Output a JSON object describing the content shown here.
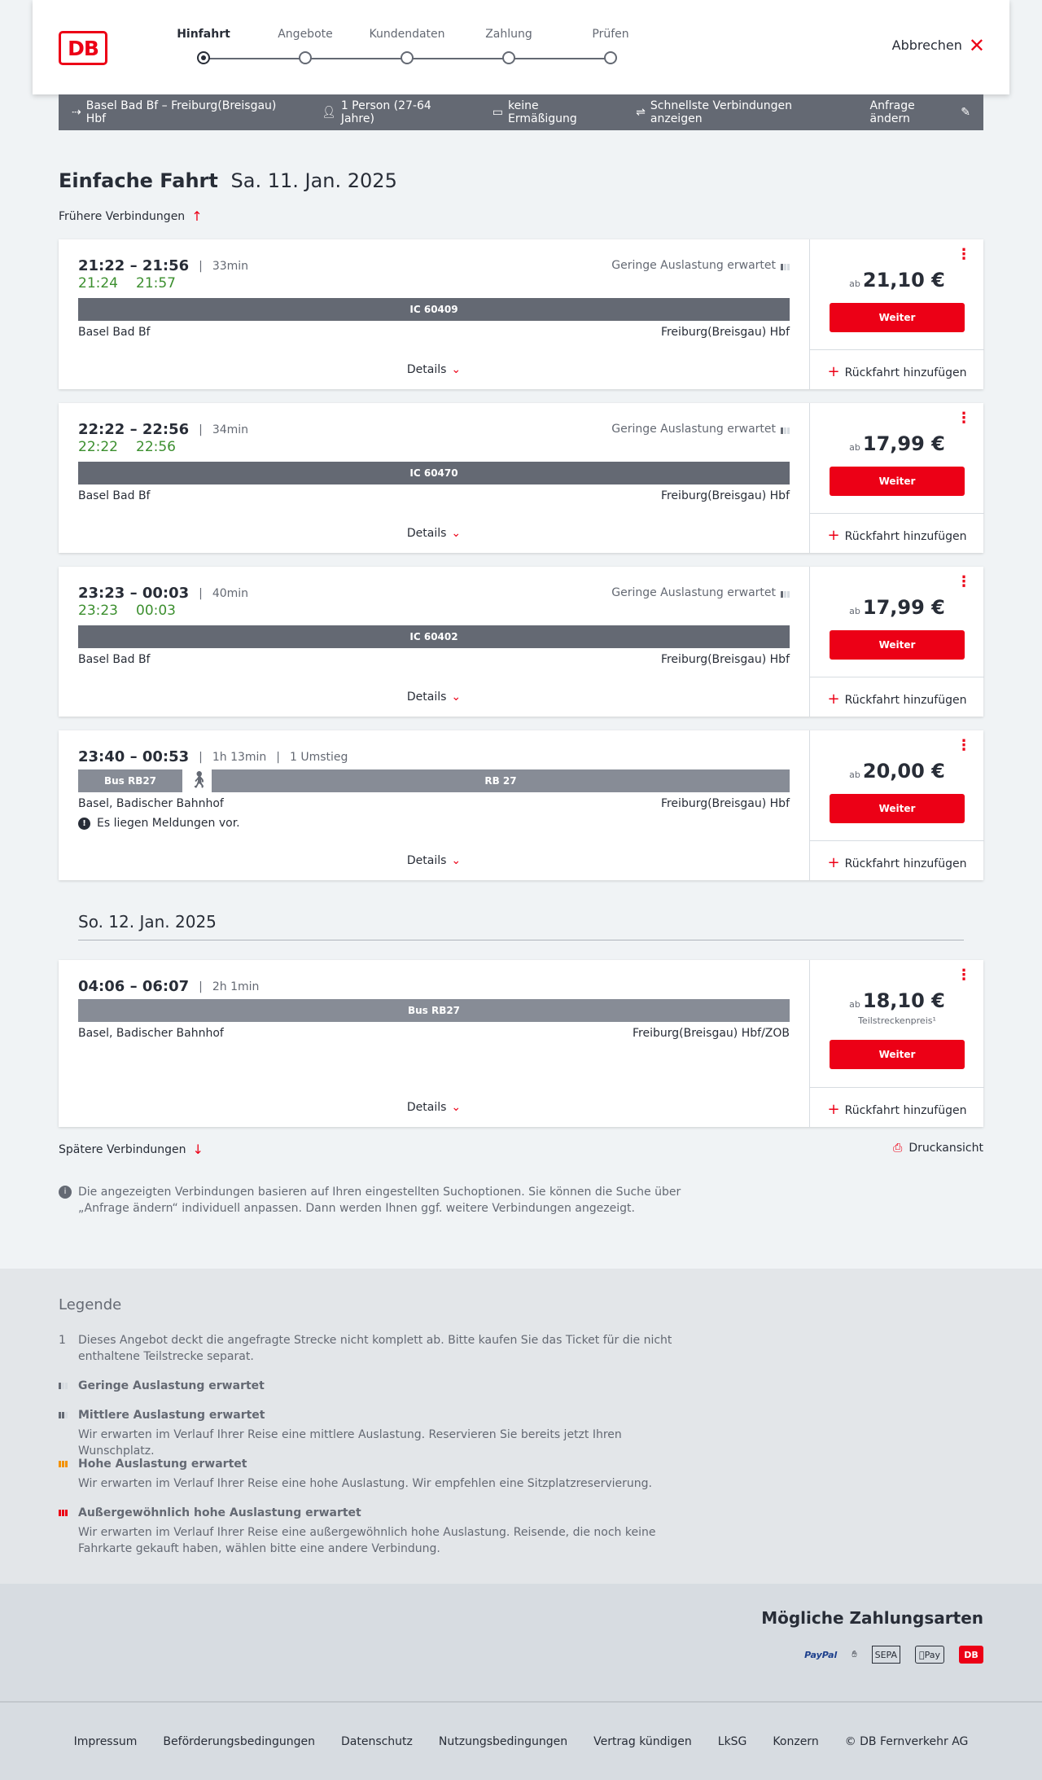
{
  "header": {
    "logo": "DB",
    "steps": [
      "Hinfahrt",
      "Angebote",
      "Kundendaten",
      "Zahlung",
      "Prüfen"
    ],
    "cancel": "Abbrechen"
  },
  "summary": {
    "route": "Basel Bad Bf – Freiburg(Breisgau) Hbf",
    "passengers": "1 Person (27-64 Jahre)",
    "discount": "keine Ermäßigung",
    "option": "Schnellste Verbindungen anzeigen",
    "edit": "Anfrage ändern"
  },
  "title": {
    "main": "Einfache Fahrt",
    "date": "Sa. 11. Jan. 2025"
  },
  "earlier": "Frühere Verbindungen",
  "later": "Spätere Verbindungen",
  "print": "Druckansicht",
  "connections": [
    {
      "times": "21:22 – 21:56",
      "duration": "33min",
      "transfers": "",
      "rt_dep": "21:24",
      "rt_arr": "21:57",
      "load": "Geringe Auslastung erwartet",
      "trains": [
        "IC 60409"
      ],
      "from": "Basel Bad Bf",
      "to": "Freiburg(Breisgau) Hbf",
      "details": "Details",
      "ab": "ab",
      "price": "21,10 €",
      "partial": "",
      "weiter": "Weiter",
      "return": "Rückfahrt hinzufügen",
      "notice": ""
    },
    {
      "times": "22:22 – 22:56",
      "duration": "34min",
      "transfers": "",
      "rt_dep": "22:22",
      "rt_arr": "22:56",
      "load": "Geringe Auslastung erwartet",
      "trains": [
        "IC 60470"
      ],
      "from": "Basel Bad Bf",
      "to": "Freiburg(Breisgau) Hbf",
      "details": "Details",
      "ab": "ab",
      "price": "17,99 €",
      "partial": "",
      "weiter": "Weiter",
      "return": "Rückfahrt hinzufügen",
      "notice": ""
    },
    {
      "times": "23:23 – 00:03",
      "duration": "40min",
      "transfers": "",
      "rt_dep": "23:23",
      "rt_arr": "00:03",
      "load": "Geringe Auslastung erwartet",
      "trains": [
        "IC 60402"
      ],
      "from": "Basel Bad Bf",
      "to": "Freiburg(Breisgau) Hbf",
      "details": "Details",
      "ab": "ab",
      "price": "17,99 €",
      "partial": "",
      "weiter": "Weiter",
      "return": "Rückfahrt hinzufügen",
      "notice": ""
    },
    {
      "times": "23:40 – 00:53",
      "duration": "1h 13min",
      "transfers": "1 Umstieg",
      "rt_dep": "",
      "rt_arr": "",
      "load": "",
      "trains": [
        "Bus RB27",
        "RB 27"
      ],
      "from": "Basel, Badischer Bahnhof",
      "to": "Freiburg(Breisgau) Hbf",
      "details": "Details",
      "ab": "ab",
      "price": "20,00 €",
      "partial": "",
      "weiter": "Weiter",
      "return": "Rückfahrt hinzufügen",
      "notice": "Es liegen Meldungen vor."
    },
    {
      "times": "04:06 – 06:07",
      "duration": "2h 1min",
      "transfers": "",
      "rt_dep": "",
      "rt_arr": "",
      "load": "",
      "trains": [
        "Bus RB27"
      ],
      "from": "Basel, Badischer Bahnhof",
      "to": "Freiburg(Breisgau) Hbf/ZOB",
      "details": "Details",
      "ab": "ab",
      "price": "18,10 €",
      "partial": "Teilstreckenpreis¹",
      "weiter": "Weiter",
      "return": "Rückfahrt hinzufügen",
      "notice": ""
    }
  ],
  "next_date": "So. 12. Jan. 2025",
  "info_note": "Die angezeigten Verbindungen basieren auf Ihren eingestellten Suchoptionen. Sie können die Suche über „Anfrage ändern“ individuell anpassen. Dann werden Ihnen ggf. weitere Verbindungen angezeigt.",
  "legend": {
    "title": "Legende",
    "footnote_num": "1",
    "footnote": "Dieses Angebot deckt die angefragte Strecke nicht komplett ab. Bitte kaufen Sie das Ticket für die nicht enthaltene Teilstrecke separat.",
    "low": "Geringe Auslastung erwartet",
    "medium": "Mittlere Auslastung erwartet",
    "medium_text": "Wir erwarten im Verlauf Ihrer Reise eine mittlere Auslastung. Reservieren Sie bereits jetzt Ihren Wunschplatz.",
    "high": "Hohe Auslastung erwartet",
    "high_text": "Wir erwarten im Verlauf Ihrer Reise eine hohe Auslastung. Wir empfehlen eine Sitzplatzreservierung.",
    "extreme": "Außergewöhnlich hohe Auslastung erwartet",
    "extreme_text": "Wir erwarten im Verlauf Ihrer Reise eine außergewöhnlich hohe Auslastung. Reisende, die noch keine Fahrkarte gekauft haben, wählen bitte eine andere Verbindung."
  },
  "payment": {
    "title": "Mögliche Zahlungsarten",
    "methods": [
      "PayPal",
      "SEPA",
      "Pay",
      "DB"
    ]
  },
  "footer": [
    "Impressum",
    "Beförderungsbedingungen",
    "Datenschutz",
    "Nutzungsbedingungen",
    "Vertrag kündigen",
    "LkSG",
    "Konzern",
    "© DB Fernverkehr AG"
  ]
}
